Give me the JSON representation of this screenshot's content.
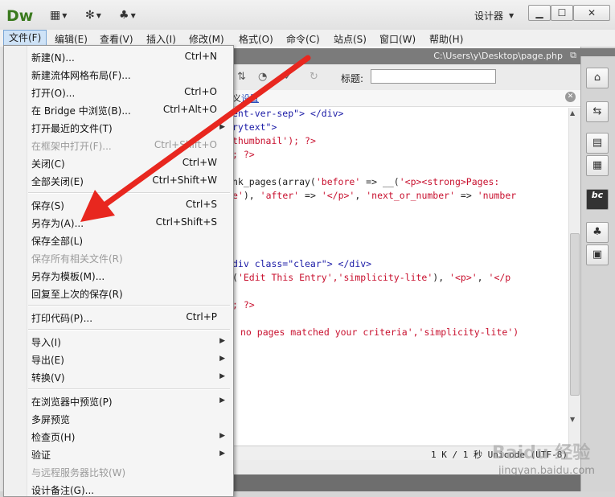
{
  "app": {
    "logo": "Dw",
    "workspace": "设计器"
  },
  "titlebar": {
    "icons": [
      "layout-icon",
      "gear-icon",
      "site-icon"
    ],
    "min": "▁",
    "max": "☐",
    "close": "✕"
  },
  "menubar": {
    "items": [
      "文件(F)",
      "编辑(E)",
      "查看(V)",
      "插入(I)",
      "修改(M)",
      "格式(O)",
      "命令(C)",
      "站点(S)",
      "窗口(W)",
      "帮助(H)"
    ]
  },
  "file_menu": {
    "items": [
      {
        "label": "新建(N)...",
        "shortcut": "Ctrl+N"
      },
      {
        "label": "新建流体网格布局(F)...",
        "shortcut": ""
      },
      {
        "label": "打开(O)...",
        "shortcut": "Ctrl+O"
      },
      {
        "label": "在 Bridge 中浏览(B)...",
        "shortcut": "Ctrl+Alt+O"
      },
      {
        "label": "打开最近的文件(T)",
        "shortcut": ""
      },
      {
        "label": "在框架中打开(F)...",
        "shortcut": "Ctrl+Shift+O"
      },
      {
        "label": "关闭(C)",
        "shortcut": "Ctrl+W"
      },
      {
        "label": "全部关闭(E)",
        "shortcut": "Ctrl+Shift+W"
      },
      {
        "label": "保存(S)",
        "shortcut": "Ctrl+S"
      },
      {
        "label": "另存为(A)...",
        "shortcut": "Ctrl+Shift+S"
      },
      {
        "label": "保存全部(L)",
        "shortcut": ""
      },
      {
        "label": "保存所有相关文件(R)",
        "shortcut": ""
      },
      {
        "label": "另存为模板(M)...",
        "shortcut": ""
      },
      {
        "label": "回复至上次的保存(R)",
        "shortcut": ""
      },
      {
        "label": "打印代码(P)...",
        "shortcut": "Ctrl+P"
      },
      {
        "label": "导入(I)",
        "shortcut": ""
      },
      {
        "label": "导出(E)",
        "shortcut": ""
      },
      {
        "label": "转换(V)",
        "shortcut": ""
      },
      {
        "label": "在浏览器中预览(P)",
        "shortcut": ""
      },
      {
        "label": "多屏预览",
        "shortcut": ""
      },
      {
        "label": "检查页(H)",
        "shortcut": ""
      },
      {
        "label": "验证",
        "shortcut": ""
      },
      {
        "label": "与远程服务器比较(W)",
        "shortcut": ""
      },
      {
        "label": "设计备注(G)...",
        "shortcut": ""
      }
    ]
  },
  "document": {
    "path": "C:\\Users\\y\\Desktop\\page.php",
    "title_label": "标题:",
    "title_value": "",
    "info_text": "义",
    "info_link": "设置",
    "status": "1 K / 1 秒 Unicode (UTF-8)"
  },
  "code": {
    "l1a": "ent-ver-sep\">",
    "l1b": " </div>",
    "l2": "rytext\">",
    "l3a": "thumbnail'",
    "l3b": "); ?>",
    "l4": "; ?>",
    "l5a": "nk_pages(array(",
    "l5b": "'before'",
    "l5c": " => __(",
    "l5d": "'<p><strong>Pages:",
    "l6a": "e'",
    "l6b": "), ",
    "l6c": "'after'",
    "l6d": " => ",
    "l6e": "'</p>'",
    "l6f": ", ",
    "l6g": "'next_or_number'",
    "l6h": " => ",
    "l6i": "'number",
    "l7a": "div class=\"clear\">",
    "l7b": " </div>",
    "l8a": "(",
    "l8b": "'Edit This Entry','simplicity-lite'",
    "l8c": "), ",
    "l8d": "'<p>'",
    "l8e": ", ",
    "l8f": "'</p",
    "l9": "; ?>",
    "l10": "no pages matched your criteria','simplicity-lite')"
  },
  "watermark": {
    "logo": "Baidu 经验",
    "url": "jingyan.baidu.com"
  },
  "colors": {
    "arrow": "#e8271f",
    "menu_highlight": "#cfe3f7",
    "logo": "#3b7a1f"
  }
}
